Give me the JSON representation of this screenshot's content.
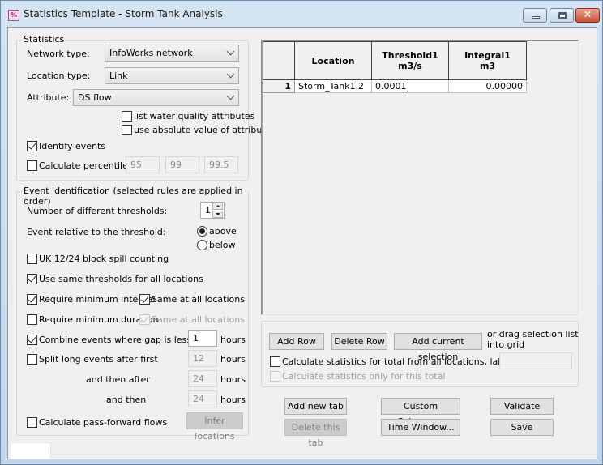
{
  "window": {
    "title": "Statistics Template - Storm Tank Analysis",
    "app_icon_glyph": "%",
    "close_glyph": "✕",
    "colors": {
      "close_button": "#c8503a",
      "client_bg": "#f0f0f0"
    }
  },
  "statistics": {
    "legend": "Statistics",
    "network_type": {
      "label": "Network type:",
      "value": "InfoWorks network"
    },
    "location_type": {
      "label": "Location type:",
      "value": "Link"
    },
    "attribute": {
      "label": "Attribute:",
      "value": "DS flow"
    },
    "list_wq": {
      "label": "list water quality attributes",
      "checked": false
    },
    "use_abs": {
      "label": "use absolute value of attribute",
      "checked": false
    },
    "identify_events": {
      "label": "Identify events",
      "checked": true
    },
    "calc_percentiles": {
      "label": "Calculate percentiles:",
      "checked": false,
      "values": [
        "95",
        "99",
        "99.5"
      ]
    }
  },
  "events": {
    "legend": "Event identification (selected rules are applied in order)",
    "num_thresholds": {
      "label": "Number of different thresholds:",
      "value": "1"
    },
    "relative": {
      "label": "Event relative to the threshold:",
      "options": [
        "above",
        "below"
      ],
      "selected": "above"
    },
    "uk_block": {
      "label": "UK 12/24 block spill counting",
      "checked": false
    },
    "same_thresholds": {
      "label": "Use same thresholds for all locations",
      "checked": true
    },
    "min_integral": {
      "label": "Require minimum integral",
      "checked": true,
      "same_label": "Same at all locations",
      "same_checked": true
    },
    "min_duration": {
      "label": "Require minimum duration",
      "checked": false,
      "same_label": "Same at all locations",
      "same_checked": true
    },
    "combine": {
      "label": "Combine events where gap is less than",
      "checked": true,
      "value": "1",
      "unit": "hours"
    },
    "split": {
      "label": "Split long events after first",
      "checked": false,
      "value": "12",
      "unit": "hours"
    },
    "then_after": {
      "label": "and then after",
      "value": "24",
      "unit": "hours"
    },
    "and_then": {
      "label": "and then",
      "value": "24",
      "unit": "hours"
    },
    "pass_forward": {
      "label": "Calculate pass-forward flows",
      "checked": false,
      "infer_label": "Infer locations"
    }
  },
  "grid": {
    "columns": [
      {
        "title": ""
      },
      {
        "title": "Location",
        "unit": ""
      },
      {
        "title": "Threshold1",
        "unit": "m3/s"
      },
      {
        "title": "Integral1",
        "unit": "m3"
      }
    ],
    "rows": [
      {
        "num": "1",
        "location": "Storm_Tank1.2",
        "threshold": "0.0001",
        "integral": "0.00000"
      }
    ]
  },
  "grid_actions": {
    "add_row": "Add Row",
    "delete_row": "Delete Row",
    "add_selection": "Add current selection",
    "drag_hint_1": "or drag selection list",
    "drag_hint_2": "into grid",
    "calc_total": {
      "label": "Calculate statistics for total from all locations, labeled as:",
      "checked": false,
      "value": ""
    },
    "only_total": {
      "label": "Calculate statistics only for this total",
      "checked": false
    }
  },
  "footer": {
    "add_tab": "Add new tab",
    "delete_tab": "Delete this tab",
    "custom_columns": "Custom Columns...",
    "time_window": "Time Window...",
    "validate": "Validate",
    "save": "Save"
  }
}
